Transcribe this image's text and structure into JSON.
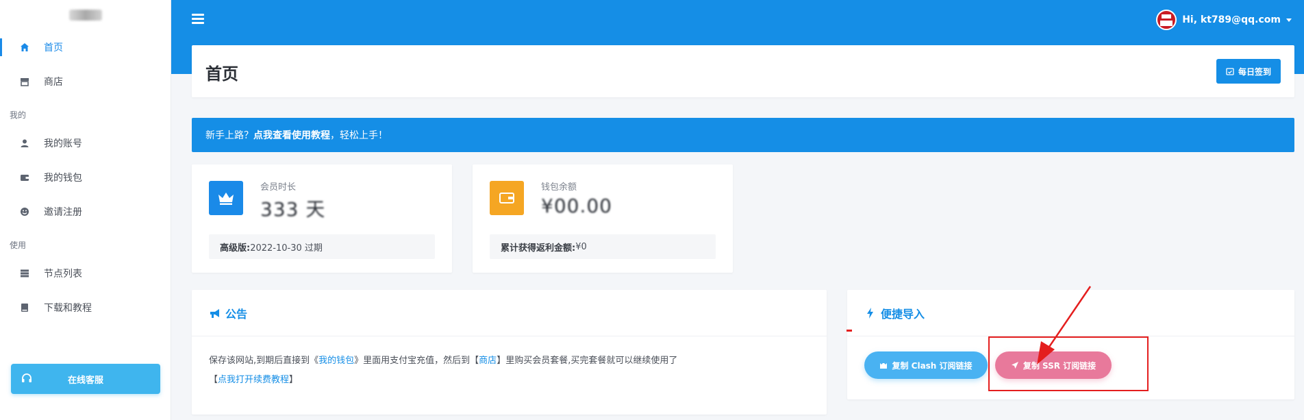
{
  "sidebar": {
    "items": [
      {
        "label": "首页",
        "icon": "home-icon"
      },
      {
        "label": "商店",
        "icon": "store-icon"
      },
      {
        "label": "我的账号",
        "icon": "user-icon"
      },
      {
        "label": "我的钱包",
        "icon": "wallet-icon"
      },
      {
        "label": "邀请注册",
        "icon": "smile-icon"
      },
      {
        "label": "节点列表",
        "icon": "server-icon"
      },
      {
        "label": "下载和教程",
        "icon": "book-icon"
      }
    ],
    "sections": [
      "我的",
      "使用"
    ],
    "support_label": "在线客服"
  },
  "header": {
    "user": "Hi, kt789@qq.com"
  },
  "page": {
    "title": "首页",
    "checkin_label": "每日签到"
  },
  "alert": {
    "prefix": "新手上路？",
    "link": "点我查看使用教程",
    "suffix": "，轻松上手！"
  },
  "stats": {
    "member": {
      "label": "会员时长",
      "value": "333 天",
      "foot_label": "高级版:",
      "foot_value": " 2022-10-30 过期"
    },
    "wallet": {
      "label": "钱包余额",
      "value": "¥00.00",
      "foot_label": "累计获得返利金额:",
      "foot_value": " ¥0"
    }
  },
  "notice": {
    "title": "公告",
    "line1_a": "保存该网站,到期后直接到《",
    "line1_link1": "我的钱包",
    "line1_b": "》里面用支付宝充值，然后到【",
    "line1_link2": "商店",
    "line1_c": "】里购买会员套餐,买完套餐就可以继续使用了",
    "line2_a": "【",
    "line2_link": "点我打开续费教程",
    "line2_b": "】"
  },
  "quick": {
    "title": "便捷导入",
    "clash_label": "复制 Clash 订阅链接",
    "ssr_label": "复制 SSR 订阅链接"
  },
  "colors": {
    "primary": "#158ee6",
    "clash": "#49b2f2",
    "ssr": "#e8799b",
    "annotation": "#e41e1e",
    "member_icon": "#1a8ae8",
    "wallet_icon": "#f5a623"
  }
}
